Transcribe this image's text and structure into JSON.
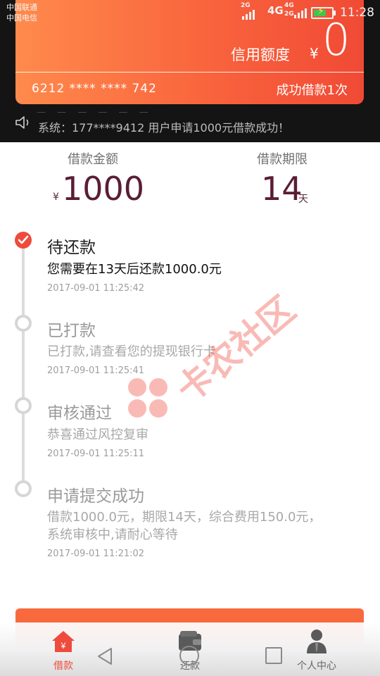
{
  "status_bar": {
    "carrier_1": "中国联通",
    "carrier_2": "中国电信",
    "network_2g": "2G",
    "network_4g": "4G",
    "network_4g_small": "4G",
    "network_2g_small": "2G",
    "time": "11:28",
    "battery_level": 0.7
  },
  "card": {
    "credit_label": "信用额度",
    "currency": "¥",
    "credit_value": "0",
    "card_number": "6212 **** ****  742",
    "success_count": "成功借款1次"
  },
  "notice": {
    "icon": "speaker-icon",
    "text": "系统：177****9412 用户申请1000元借款成功！"
  },
  "loan": {
    "amount_label": "借款金额",
    "amount_currency": "¥",
    "amount_value": "1000",
    "term_label": "借款期限",
    "term_value": "14",
    "term_unit": "天"
  },
  "timeline": [
    {
      "status": "active",
      "title": "待还款",
      "desc": "您需要在13天后还款1000.0元",
      "time": "2017-09-01 11:25:42"
    },
    {
      "status": "done",
      "title": "已打款",
      "desc": "已打款,请查看您的提现银行卡",
      "time": "2017-09-01 11:25:41"
    },
    {
      "status": "done",
      "title": "审核通过",
      "desc": "恭喜通过风控复审",
      "time": "2017-09-01 11:25:11"
    },
    {
      "status": "done",
      "title": "申请提交成功",
      "desc_line1": "借款1000.0元，期限14天，综合费用150.0元，",
      "desc_line2": "系统审核中,请耐心等待",
      "time": "2017-09-01 11:21:02"
    }
  ],
  "watermark": {
    "text": "卡农社区"
  },
  "tabbar": {
    "items": [
      {
        "label": "借款",
        "icon": "home-yen-icon",
        "active": true
      },
      {
        "label": "还款",
        "icon": "wallet-icon",
        "active": false
      },
      {
        "label": "个人中心",
        "icon": "user-icon",
        "active": false
      }
    ]
  },
  "colors": {
    "accent": "#ee4b3c",
    "card_gradient_start": "#ff8a4c",
    "card_gradient_end": "#f04a35",
    "amount_text": "#5a1d35"
  }
}
